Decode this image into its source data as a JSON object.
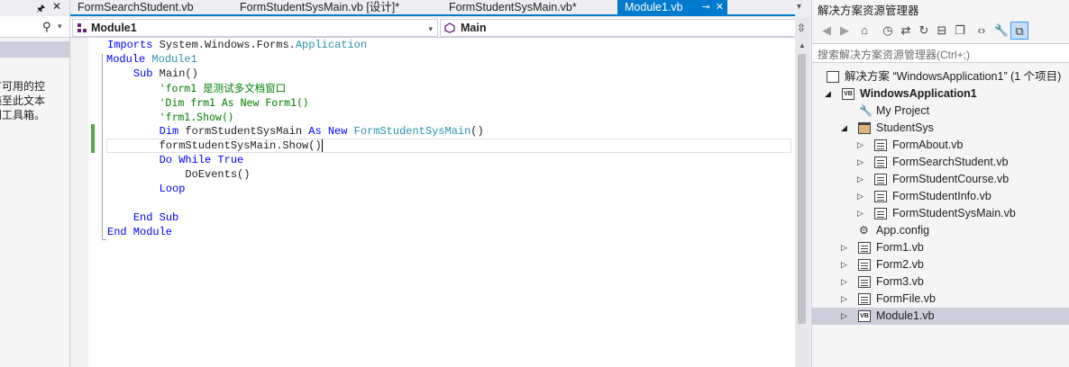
{
  "toolbox": {
    "message": "有可用的控\n拖至此文本\n到工具箱。"
  },
  "tabs": [
    {
      "label": "FormSearchStudent.vb"
    },
    {
      "label": "FormStudentSysMain.vb [设计]*"
    },
    {
      "label": "FormStudentSysMain.vb*"
    },
    {
      "label": "Module1.vb"
    }
  ],
  "navbar": {
    "left_value": "Module1",
    "right_value": "Main"
  },
  "code": {
    "l1_imports": "Imports",
    "l1_ns": "System.Windows.Forms.",
    "l1_type": "Application",
    "l2_module": "Module",
    "l2_name": "Module1",
    "l3_sub": "Sub",
    "l3_rest": " Main()",
    "l4_comment": "'form1 是测试多文档窗口",
    "l5_comment": "'Dim frm1 As New Form1()",
    "l6_comment": "'frm1.Show()",
    "l7_dim": "Dim",
    "l7_var": " formStudentSysMain ",
    "l7_as": "As",
    "l7_new": "New",
    "l7_type": "FormStudentSysMain",
    "l7_paren": "()",
    "l8_text": "formStudentSysMain.Show()",
    "l9_do": "Do While True",
    "l10_text": "DoEvents()",
    "l11_loop": "Loop",
    "l13_endsub": "End Sub",
    "l14_endmodule": "End Module"
  },
  "solution_explorer": {
    "title": "解决方案资源管理器",
    "search_placeholder": "搜索解决方案资源管理器(Ctrl+;)",
    "solution_label": "解决方案 “WindowsApplication1” (1 个项目)",
    "project_label": "WindowsApplication1",
    "my_project": "My Project",
    "folder_label": "StudentSys",
    "folder_items": [
      "FormAbout.vb",
      "FormSearchStudent.vb",
      "FormStudentCourse.vb",
      "FormStudentInfo.vb",
      "FormStudentSysMain.vb"
    ],
    "app_config": "App.config",
    "files": [
      "Form1.vb",
      "Form2.vb",
      "Form3.vb",
      "FormFile.vb"
    ],
    "module1": "Module1.vb"
  }
}
